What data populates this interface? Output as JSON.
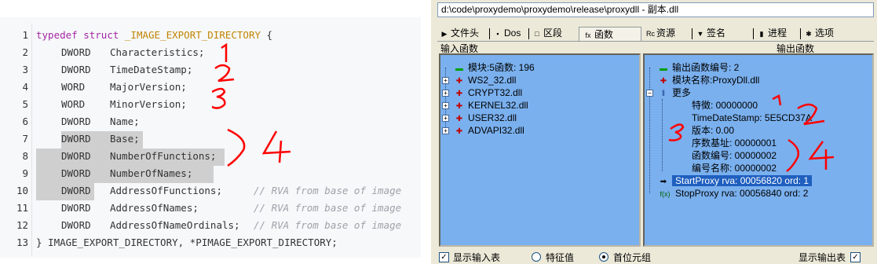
{
  "code": {
    "line_numbers": [
      "1",
      "2",
      "3",
      "4",
      "5",
      "6",
      "7",
      "8",
      "9",
      "10",
      "11",
      "12",
      "13"
    ],
    "line1": {
      "kw": "typedef",
      "kw2": "struct",
      "name": "_IMAGE_EXPORT_DIRECTORY",
      "brace": " {"
    },
    "fields": [
      {
        "type": "DWORD",
        "name": "Characteristics;"
      },
      {
        "type": "DWORD",
        "name": "TimeDateStamp;"
      },
      {
        "type": "WORD",
        "name": "MajorVersion;"
      },
      {
        "type": "WORD",
        "name": "MinorVersion;"
      },
      {
        "type": "DWORD",
        "name": "Name;"
      },
      {
        "type": "DWORD",
        "name": "Base;"
      },
      {
        "type": "DWORD",
        "name": "NumberOfFunctions;"
      },
      {
        "type": "DWORD",
        "name": "NumberOfNames;"
      },
      {
        "type": "DWORD",
        "name": "AddressOfFunctions;",
        "comment": "// RVA from base of image"
      },
      {
        "type": "DWORD",
        "name": "AddressOfNames;",
        "comment": "// RVA from base of image"
      },
      {
        "type": "DWORD",
        "name": "AddressOfNameOrdinals;",
        "comment": "// RVA from base of image"
      }
    ],
    "closing": "} IMAGE_EXPORT_DIRECTORY, *PIMAGE_EXPORT_DIRECTORY;"
  },
  "annotations": {
    "a1": "1",
    "a2": "2",
    "a3": "3",
    "a4": "4"
  },
  "window": {
    "path": "d:\\code\\proxydemo\\proxydemo\\release\\proxydll - 副本.dll",
    "tabs": [
      {
        "label": "文件头",
        "icon": "file-icon"
      },
      {
        "label": "Dos",
        "icon": "dos-icon"
      },
      {
        "label": "区段",
        "icon": "section-icon"
      },
      {
        "label": "函数",
        "icon": "function-icon",
        "selected": true
      },
      {
        "label": "资源",
        "icon": "resource-icon"
      },
      {
        "label": "签名",
        "icon": "signature-icon"
      },
      {
        "label": "进程",
        "icon": "process-icon"
      },
      {
        "label": "选项",
        "icon": "options-icon"
      }
    ],
    "import_group_label": "输入函数",
    "export_group_label": "输出函数",
    "import_tree": {
      "root": "模块:5函数: 196",
      "modules": [
        "WS2_32.dll",
        "CRYPT32.dll",
        "KERNEL32.dll",
        "USER32.dll",
        "ADVAPI32.dll"
      ]
    },
    "export_tree": {
      "count": "输出函数编号: 2",
      "module_name": "模块名称:ProxyDll.dll",
      "more": "更多",
      "details": [
        "特徵: 00000000",
        "TimeDateStamp: 5E5CD37A",
        "版本: 0.00",
        "序数基址: 00000001",
        "函数编号: 00000002",
        "编号名称: 00000002"
      ],
      "functions": [
        "StartProxy rva: 00056820 ord:  1",
        "StopProxy rva: 00056840 ord:  2"
      ],
      "function_icon_text": "f(x)"
    },
    "bottom": {
      "show_imports": "显示输入表",
      "feature": "特征值",
      "first_tuple": "首位元组",
      "show_exports": "显示输出表"
    }
  },
  "colors": {
    "panel_bg": "#7ab0ee",
    "selection": "#1f5fbf",
    "annotation": "#ff0000"
  }
}
